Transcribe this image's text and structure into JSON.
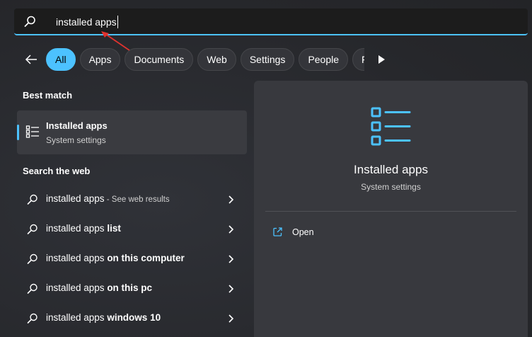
{
  "search": {
    "query": "installed apps"
  },
  "filters": [
    {
      "label": "All",
      "active": true
    },
    {
      "label": "Apps"
    },
    {
      "label": "Documents"
    },
    {
      "label": "Web"
    },
    {
      "label": "Settings"
    },
    {
      "label": "People"
    },
    {
      "label": "Folders"
    }
  ],
  "best_match": {
    "heading": "Best match",
    "title": "Installed apps",
    "subtitle": "System settings"
  },
  "web": {
    "heading": "Search the web",
    "items": [
      {
        "base": "installed apps",
        "suffix": " - See web results"
      },
      {
        "base": "installed apps ",
        "bold": "list"
      },
      {
        "base": "installed apps ",
        "bold": "on this computer"
      },
      {
        "base": "installed apps ",
        "bold": "on this pc"
      },
      {
        "base": "installed apps ",
        "bold": "windows 10"
      }
    ]
  },
  "detail": {
    "title": "Installed apps",
    "subtitle": "System settings",
    "open_label": "Open"
  },
  "colors": {
    "accent": "#4cc2ff",
    "annotation_arrow": "#e0332f"
  }
}
